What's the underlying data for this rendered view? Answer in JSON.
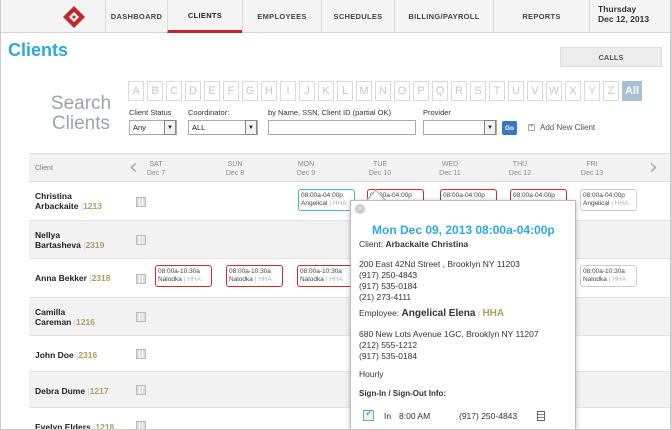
{
  "nav": {
    "items": [
      "DASHBOARD",
      "CLIENTS",
      "EMPLOYEES",
      "SCHEDULES",
      "BILLING/PAYROLL",
      "REPORTS"
    ],
    "active": "CLIENTS",
    "date_line1": "Thursday",
    "date_line2": "Dec 12, 2013",
    "brand_color": "#c0282d"
  },
  "page": {
    "title": "Clients",
    "calls_tab": "CALLS"
  },
  "search": {
    "label_line1": "Search",
    "label_line2": "Clients",
    "letters": [
      "A",
      "B",
      "C",
      "D",
      "E",
      "F",
      "G",
      "H",
      "I",
      "J",
      "K",
      "L",
      "M",
      "N",
      "O",
      "P",
      "Q",
      "R",
      "S",
      "T",
      "U",
      "V",
      "W",
      "X",
      "Y",
      "Z"
    ],
    "all_label": "All",
    "client_status_label": "Client Status",
    "client_status_value": "Any",
    "coordinator_label": "Coordinator:",
    "coordinator_value": "ALL",
    "name_label": "by Name, SSN, Client ID (partial OK)",
    "provider_label": "Provider",
    "go_label": "Go",
    "add_new_label": "Add New Client"
  },
  "grid": {
    "client_header": "Client",
    "days": [
      {
        "dow": "SAT",
        "date": "Dec 7"
      },
      {
        "dow": "SUN",
        "date": "Dec 8"
      },
      {
        "dow": "MON",
        "date": "Dec 9"
      },
      {
        "dow": "TUE",
        "date": "Dec 10"
      },
      {
        "dow": "WED",
        "date": "Dec 11"
      },
      {
        "dow": "THU",
        "date": "Dec 12"
      },
      {
        "dow": "FRI",
        "date": "Dec 13"
      }
    ],
    "clients": [
      {
        "first": "Christina",
        "last": "Arbackaite",
        "id": "1213"
      },
      {
        "first": "Nellya",
        "last": "Bartasheva",
        "id": "2319"
      },
      {
        "first": "Anna Bekker",
        "last": "",
        "id": "2318"
      },
      {
        "first": "Camilla",
        "last": "Careman",
        "id": "1216"
      },
      {
        "first": "John Doe",
        "last": "",
        "id": "2316"
      },
      {
        "first": "Debra Dume",
        "last": "",
        "id": "1217"
      },
      {
        "first": "Evelyn Elders",
        "last": "",
        "id": "1218"
      }
    ],
    "shift_time": "08:00a-04:00p",
    "shift_time_b": "08:00a-10:30a",
    "emp_a": "Angelical",
    "emp_b": "Nalodka",
    "hha": "HHA",
    "sep": "|"
  },
  "popup": {
    "title": "Mon Dec 09, 2013 08:00a-04:00p",
    "client_label": "Client:",
    "client_name": "Arbackaite Christina",
    "client_addr": "200 East 42Nd Street , Brooklyn NY 11203",
    "client_phones": [
      "(917) 250-4843",
      "(917) 535-0184",
      "(21) 273-4111"
    ],
    "employee_label": "Employee:",
    "employee_name": "Angelical Elena",
    "employee_type": "HHA",
    "employee_addr": "680 New Lots Avenue 1GC, Brooklyn NY 11207",
    "employee_phones": [
      "(212) 555-1212",
      "(917) 535-0184"
    ],
    "pay_type": "Hourly",
    "sign_label": "Sign-In / Sign-Out Info:",
    "sign_in_label": "In",
    "sign_in_time": "8:00 AM",
    "sign_in_phone": "(917) 250-4843"
  }
}
